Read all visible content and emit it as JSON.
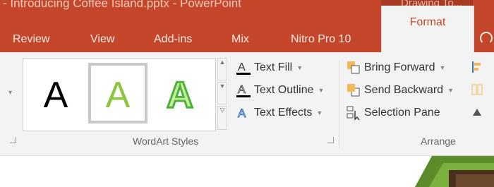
{
  "window": {
    "title": "- Introducing Coffee Island.pptx - PowerPoint",
    "contextual_title": "Drawing To..."
  },
  "tabs": [
    "Review",
    "View",
    "Add-ins",
    "Mix",
    "Nitro Pro 10"
  ],
  "active_tab": "Format",
  "wordart_styles": {
    "label": "WordArt Styles",
    "samples": [
      {
        "letter": "A",
        "style": "black-fill",
        "color": "#000000",
        "selected": false
      },
      {
        "letter": "A",
        "style": "green-fill",
        "color": "#8cc63f",
        "selected": true
      },
      {
        "letter": "A",
        "style": "green-outline-gradient",
        "color": "#6cc04a",
        "selected": false
      }
    ],
    "commands": {
      "text_fill": "Text Fill",
      "text_outline": "Text Outline",
      "text_effects": "Text Effects"
    }
  },
  "arrange": {
    "label": "Arrange",
    "commands": {
      "bring_forward": "Bring Forward",
      "send_backward": "Send Backward",
      "selection_pane": "Selection Pane"
    }
  },
  "colors": {
    "accent": "#c4472b",
    "ribbon_bg": "#f3f3f3",
    "outline_blue": "#3a6fc4"
  }
}
